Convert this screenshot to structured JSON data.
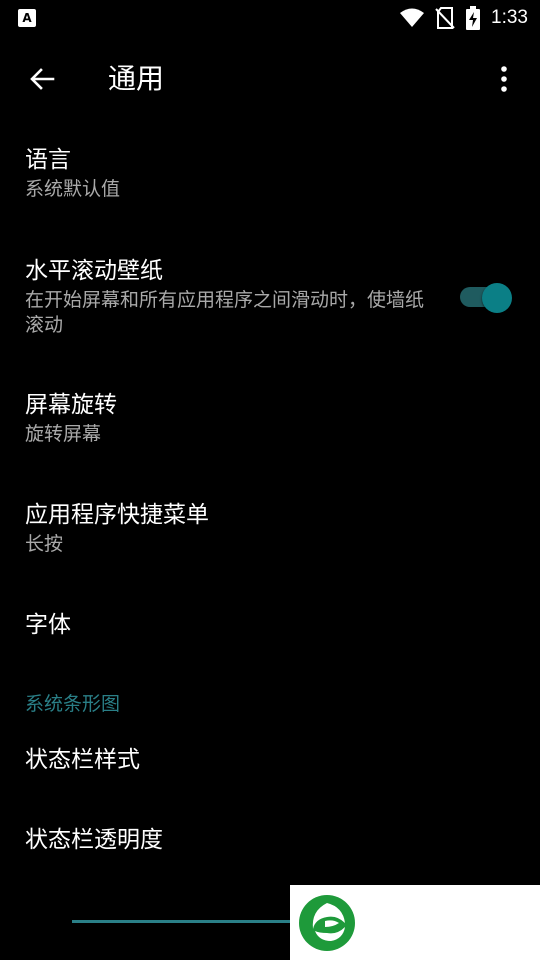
{
  "status_bar": {
    "time": "1:33",
    "left_icon": "A",
    "icons": [
      "wifi-icon",
      "no-sim-icon",
      "battery-charging-icon"
    ]
  },
  "app_bar": {
    "title": "通用"
  },
  "settings": {
    "language": {
      "title": "语言",
      "summary": "系统默认值"
    },
    "scroll_wallpaper": {
      "title": "水平滚动壁纸",
      "summary": "在开始屏幕和所有应用程序之间滑动时，使墙纸滚动",
      "enabled": true
    },
    "screen_rotation": {
      "title": "屏幕旋转",
      "summary": "旋转屏幕"
    },
    "app_shortcuts": {
      "title": "应用程序快捷菜单",
      "summary": "长按"
    },
    "font": {
      "title": "字体"
    }
  },
  "section": {
    "header": "系统条形图",
    "items": {
      "statusbar_style": {
        "title": "状态栏样式"
      },
      "statusbar_transparency": {
        "title": "状态栏透明度"
      }
    }
  },
  "colors": {
    "accent": "#2a7f87",
    "toggle_thumb": "#0b7f86",
    "toggle_track": "#1f5b5f",
    "background": "#000000",
    "summary_text": "#a9a9a9"
  }
}
